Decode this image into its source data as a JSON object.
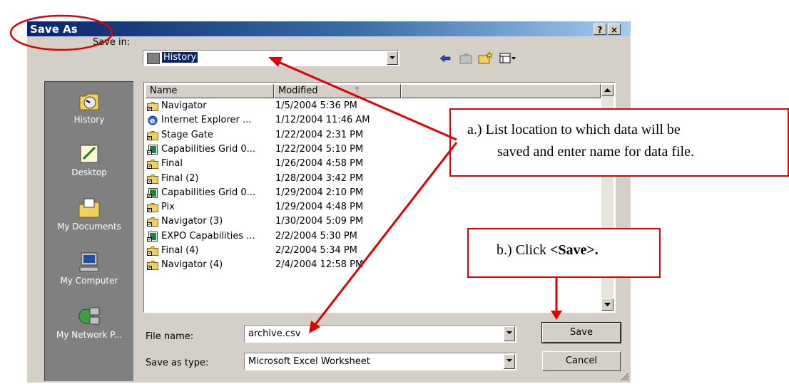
{
  "dialog": {
    "title": "Save As",
    "help_button": "?",
    "close_button": "×",
    "save_in_label": "Save in:",
    "save_in_value": "History",
    "places": [
      {
        "label": "History",
        "icon": "history-icon"
      },
      {
        "label": "Desktop",
        "icon": "desktop-icon"
      },
      {
        "label": "My Documents",
        "icon": "my-documents-icon"
      },
      {
        "label": "My Computer",
        "icon": "my-computer-icon"
      },
      {
        "label": "My Network P...",
        "icon": "my-network-places-icon"
      }
    ],
    "columns": {
      "name": "Name",
      "modified": "Modified"
    },
    "files": [
      {
        "name": "Navigator",
        "modified": "1/5/2004 5:36 PM",
        "icon": "folder-shortcut-icon"
      },
      {
        "name": "Internet Explorer ...",
        "modified": "1/12/2004 11:46 AM",
        "icon": "ie-icon"
      },
      {
        "name": "Stage Gate",
        "modified": "1/22/2004 2:31 PM",
        "icon": "folder-shortcut-icon"
      },
      {
        "name": "Capabilities Grid 0...",
        "modified": "1/22/2004 5:10 PM",
        "icon": "excel-shortcut-icon"
      },
      {
        "name": "Final",
        "modified": "1/26/2004 4:58 PM",
        "icon": "folder-shortcut-icon"
      },
      {
        "name": "Final (2)",
        "modified": "1/28/2004 3:42 PM",
        "icon": "folder-shortcut-icon"
      },
      {
        "name": "Capabilities Grid 0...",
        "modified": "1/29/2004 2:10 PM",
        "icon": "excel-shortcut-icon"
      },
      {
        "name": "Pix",
        "modified": "1/29/2004 4:48 PM",
        "icon": "folder-shortcut-icon"
      },
      {
        "name": "Navigator (3)",
        "modified": "1/30/2004 5:09 PM",
        "icon": "folder-shortcut-icon"
      },
      {
        "name": "EXPO Capabilities ...",
        "modified": "2/2/2004 5:30 PM",
        "icon": "excel-shortcut-icon"
      },
      {
        "name": "Final (4)",
        "modified": "2/2/2004 5:34 PM",
        "icon": "folder-shortcut-icon"
      },
      {
        "name": "Navigator (4)",
        "modified": "2/4/2004 12:58 PM",
        "icon": "folder-shortcut-icon"
      }
    ],
    "file_name_label": "File name:",
    "file_name_value": "archive.csv",
    "save_as_type_label": "Save as type:",
    "save_as_type_value": "Microsoft Excel Worksheet",
    "save_button": "Save",
    "cancel_button": "Cancel"
  },
  "callouts": {
    "a_line1": "a.)  List location to which data will be",
    "a_line2": "saved and enter name for data file.",
    "b_prefix": "b.)  Click ",
    "b_bold": "<Save>."
  },
  "colors": {
    "annotation": "#e00000",
    "title_bar": "#0a246a",
    "dialog_face": "#d4d0c8"
  }
}
